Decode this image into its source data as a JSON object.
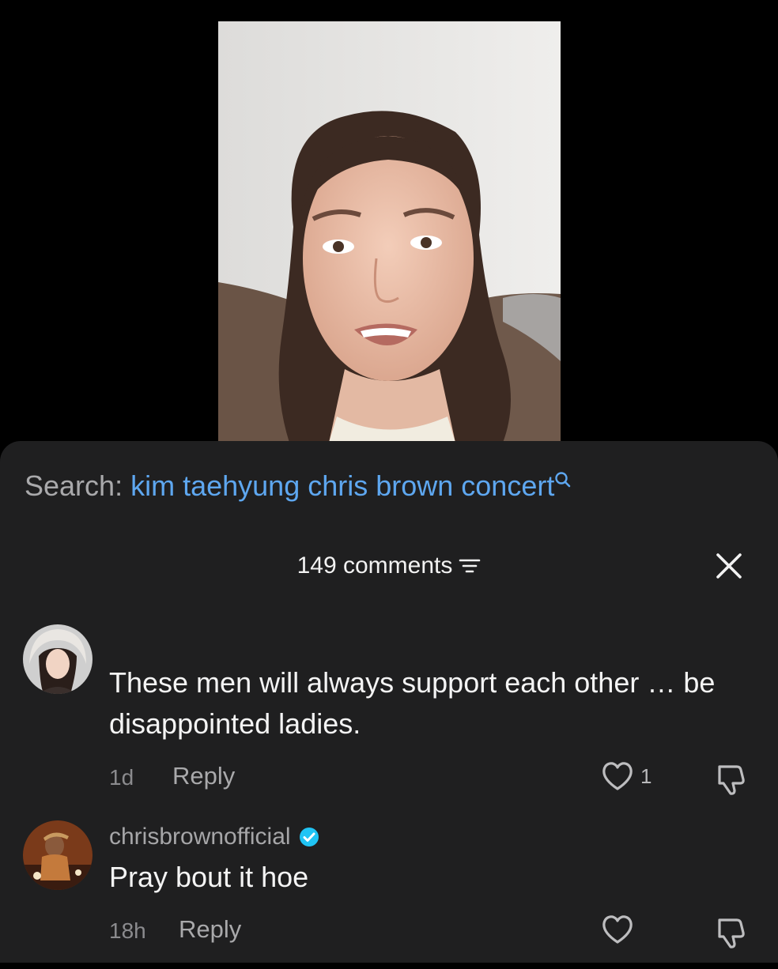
{
  "search": {
    "prefix": "Search:",
    "query": "kim taehyung chris brown concert"
  },
  "header": {
    "comment_count_label": "149 comments"
  },
  "comments": [
    {
      "username": "",
      "text": "These men will always support each other … be disappointed ladies.",
      "age": "1d",
      "reply_label": "Reply",
      "likes": "1"
    },
    {
      "username": "chrisbrownofficial",
      "verified": true,
      "text": "Pray bout it hoe",
      "age": "18h",
      "reply_label": "Reply",
      "likes": ""
    }
  ],
  "colors": {
    "accent_link": "#5ea7f0",
    "sheet_background": "#1f1f20",
    "verified_badge": "#20c4f4"
  }
}
